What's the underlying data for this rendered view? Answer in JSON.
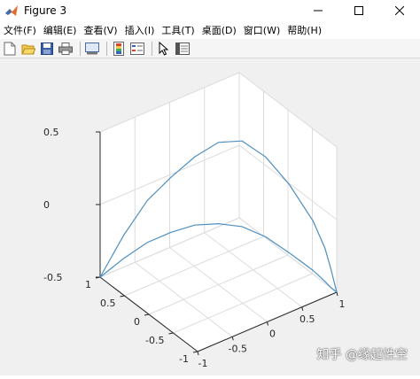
{
  "window": {
    "title": "Figure 3"
  },
  "menu": [
    {
      "label": "文件(F)"
    },
    {
      "label": "编辑(E)"
    },
    {
      "label": "查看(V)"
    },
    {
      "label": "插入(I)"
    },
    {
      "label": "工具(T)"
    },
    {
      "label": "桌面(D)"
    },
    {
      "label": "窗口(W)"
    },
    {
      "label": "帮助(H)"
    }
  ],
  "toolbar": [
    {
      "icon": "new-figure-icon"
    },
    {
      "icon": "open-folder-icon"
    },
    {
      "icon": "save-icon"
    },
    {
      "icon": "print-icon"
    },
    {
      "icon": "link-plot-icon"
    },
    {
      "icon": "insert-colorbar-icon"
    },
    {
      "icon": "insert-legend-icon"
    },
    {
      "icon": "arrow-pointer-icon"
    },
    {
      "icon": "property-inspector-icon"
    }
  ],
  "chart_data": {
    "type": "line",
    "dimension": "3d",
    "x_ticks": [
      "-1",
      "-0.5",
      "0",
      "0.5",
      "1"
    ],
    "y_ticks": [
      "-1",
      "-0.5",
      "0",
      "0.5",
      "1"
    ],
    "z_ticks": [
      "-0.5",
      "0",
      "0.5"
    ],
    "xlim": [
      -1,
      1
    ],
    "ylim": [
      -1,
      1
    ],
    "zlim": [
      -0.5,
      0.5
    ],
    "grid": true,
    "line_color": "#4d8fc1",
    "series": [
      {
        "x": [
          -1,
          -0.8,
          -0.6,
          -0.4,
          -0.2,
          0,
          0.2,
          0.4,
          0.6,
          0.8,
          0.9,
          0.95,
          1
        ],
        "y": [
          1,
          0.8,
          0.6,
          0.4,
          0.2,
          0,
          -0.2,
          -0.4,
          -0.6,
          -0.8,
          -0.9,
          -0.95,
          -1
        ],
        "z": [
          -0.5,
          -0.36,
          -0.24,
          -0.16,
          -0.1,
          -0.08,
          -0.09,
          -0.15,
          -0.25,
          -0.36,
          -0.43,
          -0.47,
          -0.5
        ]
      },
      {
        "x": [
          -1,
          -0.8,
          -0.6,
          -0.4,
          -0.2,
          0,
          0.2,
          0.4,
          0.6,
          0.8,
          0.9,
          0.95,
          1
        ],
        "y": [
          1,
          0.8,
          0.6,
          0.4,
          0.2,
          0,
          -0.2,
          -0.4,
          -0.6,
          -0.8,
          -0.9,
          -0.95,
          -1
        ],
        "z": [
          -0.5,
          -0.2,
          0.05,
          0.22,
          0.37,
          0.48,
          0.5,
          0.4,
          0.22,
          -0.02,
          -0.2,
          -0.34,
          -0.5
        ]
      }
    ]
  },
  "watermark": "知乎 @缘起性空"
}
